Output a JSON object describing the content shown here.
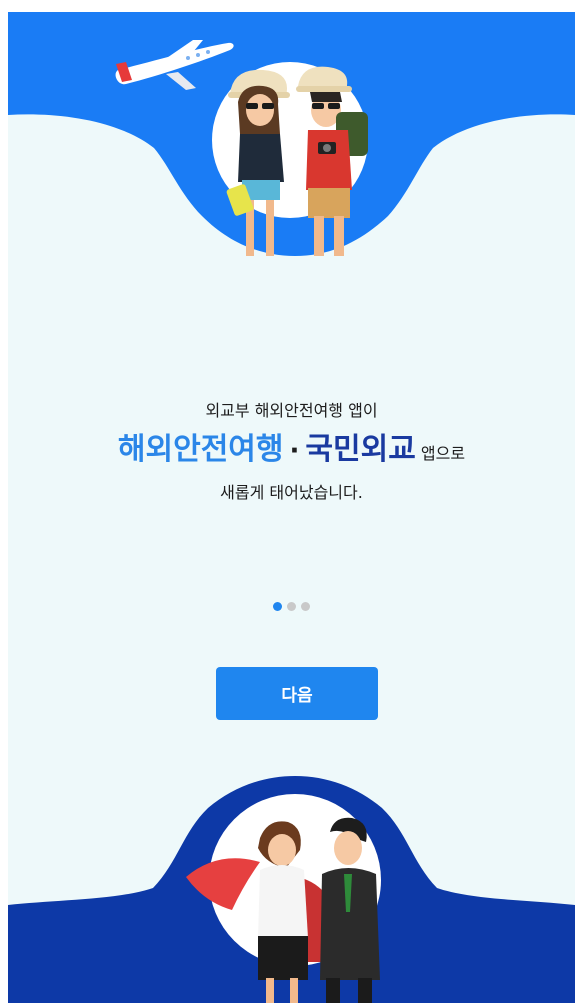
{
  "intro": {
    "line1": "외교부 해외안전여행 앱이",
    "highlight_1": "해외안전여행",
    "separator": "·",
    "highlight_2": "국민외교",
    "line2_suffix": "앱으로",
    "line3": "새롭게 태어났습니다."
  },
  "pager": {
    "total": 3,
    "active_index": 0
  },
  "next_button": {
    "label": "다음"
  },
  "colors": {
    "brand_blue": "#1a7cf5",
    "button_blue": "#1f86ef",
    "highlight_blue": "#2b86e8",
    "navy": "#1a3aa0",
    "bottom_navy": "#0d39a7",
    "background": "#eef9fa"
  },
  "icons": [
    "airplane-icon",
    "tourist-couple-illustration",
    "diplomat-couple-illustration"
  ]
}
